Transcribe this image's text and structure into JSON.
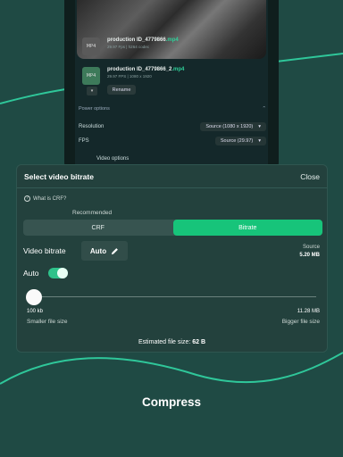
{
  "preview": {
    "file1": {
      "name": "production ID_4779866",
      "ext": ".mp4",
      "meta": "29.97 Fps  |  h264 codec",
      "thumb": "MP4"
    },
    "file2": {
      "name": "production ID_4779866_2",
      "ext": ".mp4",
      "meta": "29.97 FPS  |  1080 x 1920",
      "thumb": "MP4"
    },
    "rename_label": "Rename",
    "power_options": "Power options",
    "resolution_label": "Resolution",
    "resolution_value": "Source (1080 x 1920)",
    "fps_label": "FPS",
    "fps_value": "Source (29.97)",
    "video_options": "Video options"
  },
  "sheet": {
    "title": "Select video bitrate",
    "close_label": "Close",
    "crf_question": "What is CRF?",
    "recommended": "Recommended",
    "tabs": [
      {
        "label": "CRF",
        "active": false
      },
      {
        "label": "Bitrate",
        "active": true
      }
    ],
    "video_bitrate_label": "Video bitrate",
    "bitrate_value": "Auto",
    "source_label": "Source",
    "source_value": "5.20 MB",
    "auto_label": "Auto",
    "auto_enabled": true,
    "slider": {
      "fraction": 0.0,
      "min_label": "100 kb",
      "min_caption": "Smaller file size",
      "max_label": "11.28 MB",
      "max_caption": "Bigger file size"
    },
    "estimated_prefix": "Estimated file size: ",
    "estimated_value": "62 B"
  },
  "footer": {
    "title": "Compress"
  },
  "colors": {
    "background": "#1f4a44",
    "accent": "#17c47a",
    "sheet": "#23413d"
  }
}
